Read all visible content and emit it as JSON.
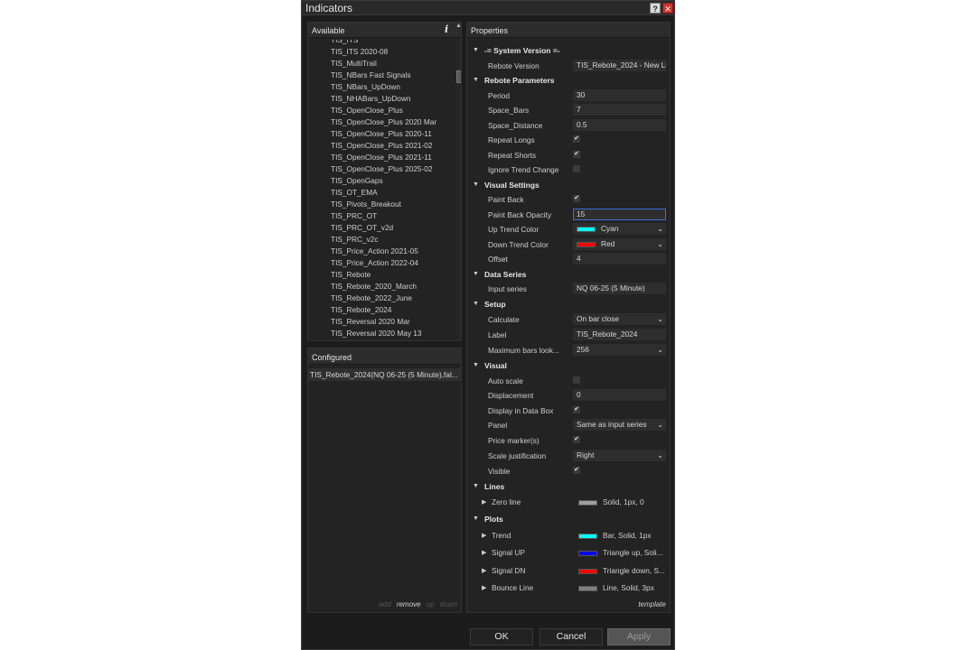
{
  "window": {
    "title": "Indicators",
    "help_label": "?",
    "close_label": "✕"
  },
  "available": {
    "header": "Available",
    "info_icon": "i",
    "sort_icon": "▲▼",
    "items": [
      "TIS_ITS",
      "TIS_ITS   2020-08",
      "TIS_MultiTrail",
      "TIS_NBars Fast Signals",
      "TIS_NBars_UpDown",
      "TIS_NHABars_UpDown",
      "TIS_OpenClose_Plus",
      "TIS_OpenClose_Plus 2020 Mar",
      "TIS_OpenClose_Plus 2020-11",
      "TIS_OpenClose_Plus 2021-02",
      "TIS_OpenClose_Plus 2021-11",
      "TIS_OpenClose_Plus 2025-02",
      "TIS_OpenGaps",
      "TIS_OT_EMA",
      "TIS_Pivots_Breakout",
      "TIS_PRC_OT",
      "TIS_PRC_OT_v2d",
      "TIS_PRC_v2c",
      "TIS_Price_Action 2021-05",
      "TIS_Price_Action 2022-04",
      "TIS_Rebote",
      "TIS_Rebote_2020_March",
      "TIS_Rebote_2022_June",
      "TIS_Rebote_2024",
      "TIS_Reversal 2020 Mar",
      "TIS_Reversal 2020 May 13"
    ]
  },
  "configured": {
    "header": "Configured",
    "items": [
      "TIS_Rebote_2024(NQ 06-25 (5 Minute),fal..."
    ],
    "actions": {
      "add": "add",
      "remove": "remove",
      "up": "up",
      "down": "down"
    }
  },
  "properties": {
    "header": "Properties",
    "sections": {
      "system_version": {
        "title": "-= System Version =-",
        "rebote_version": {
          "label": "Rebote Version",
          "value": "TIS_Rebote_2024 - New Li"
        }
      },
      "rebote_parameters": {
        "title": "Rebote Parameters",
        "period": {
          "label": "Period",
          "value": "30"
        },
        "space_bars": {
          "label": "Space_Bars",
          "value": "7"
        },
        "space_distance": {
          "label": "Space_Distance",
          "value": "0.5"
        },
        "repeat_longs": {
          "label": "Repeat Longs",
          "checked": true
        },
        "repeat_shorts": {
          "label": "Repeat Shorts",
          "checked": true
        },
        "ignore_trend_change": {
          "label": "Ignore Trend Change",
          "checked": false
        }
      },
      "visual_settings": {
        "title": "Visual Settings",
        "paint_back": {
          "label": "Paint Back",
          "checked": true
        },
        "paint_back_opacity": {
          "label": "Paint Back Opacity",
          "value": "15"
        },
        "up_trend_color": {
          "label": "Up Trend Color",
          "value": "Cyan",
          "color": "#00ffff"
        },
        "down_trend_color": {
          "label": "Down Trend Color",
          "value": "Red",
          "color": "#ff0000"
        },
        "offset": {
          "label": "Offset",
          "value": "4"
        }
      },
      "data_series": {
        "title": "Data Series",
        "input_series": {
          "label": "Input series",
          "value": "NQ 06-25 (5 Minute)"
        }
      },
      "setup": {
        "title": "Setup",
        "calculate": {
          "label": "Calculate",
          "value": "On bar close"
        },
        "label": {
          "label": "Label",
          "value": "TIS_Rebote_2024"
        },
        "max_bars": {
          "label": "Maximum bars look...",
          "value": "256"
        }
      },
      "visual": {
        "title": "Visual",
        "auto_scale": {
          "label": "Auto scale",
          "checked": false
        },
        "displacement": {
          "label": "Displacement",
          "value": "0"
        },
        "display_in_data_box": {
          "label": "Display in Data Box",
          "checked": true
        },
        "panel": {
          "label": "Panel",
          "value": "Same as input series"
        },
        "price_markers": {
          "label": "Price marker(s)",
          "checked": true
        },
        "scale_justification": {
          "label": "Scale justification",
          "value": "Right"
        },
        "visible": {
          "label": "Visible",
          "checked": true
        }
      },
      "lines": {
        "title": "Lines",
        "zero_line": {
          "label": "Zero line",
          "value": "Solid, 1px, 0",
          "color": "#9e9e9e"
        }
      },
      "plots": {
        "title": "Plots",
        "trend": {
          "label": "Trend",
          "value": "Bar, Solid, 1px",
          "color": "#00ffff"
        },
        "signal_up": {
          "label": "Signal UP",
          "value": "Triangle up, Soli...",
          "color": "#0000ff"
        },
        "signal_dn": {
          "label": "Signal DN",
          "value": "Triangle down, S...",
          "color": "#ff0000"
        },
        "bounce_line": {
          "label": "Bounce Line",
          "value": "Line, Solid, 3px",
          "color": "#808080"
        }
      }
    },
    "template_label": "template"
  },
  "buttons": {
    "ok": "OK",
    "cancel": "Cancel",
    "apply": "Apply"
  },
  "glyphs": {
    "expanded": "▼",
    "collapsed": "▶",
    "chevron": "⌄",
    "check": "✔"
  }
}
